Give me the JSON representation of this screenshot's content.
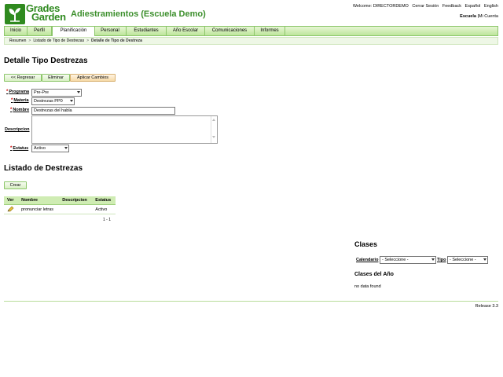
{
  "brand": {
    "line1": "Grades",
    "line2": "Garden",
    "color": "#2f8a1f"
  },
  "app_title": "Adiestramientos (Escuela Demo)",
  "top_links": [
    "Welcome: DIRECTORDEMO",
    "Cerrar Sesión",
    "Feedback",
    "Español",
    "English"
  ],
  "school": {
    "bold": "Escuela",
    "sep": "|",
    "link": "Mi Cuenta"
  },
  "nav": [
    "Inicio",
    "Perfil",
    "Planificación",
    "Personal",
    "Estudiantes",
    "Año Escolar",
    "Comunicaciones",
    "Informes"
  ],
  "nav_active": "Planificación",
  "breadcrumb": {
    "items": [
      "Resumen",
      "Listado de Tipo de Destrezas"
    ],
    "current": "Detalle de Tipo de Destreza",
    "sep": ">"
  },
  "detail": {
    "title": "Detalle Tipo Destrezas",
    "buttons": {
      "back": "<< Regresar",
      "delete": "Eliminar",
      "apply": "Aplicar Cambios"
    },
    "fields": {
      "programa": {
        "label": "Programa",
        "value": "Pre-Pre"
      },
      "materia": {
        "label": "Materia",
        "value": "Destrezas PP0"
      },
      "nombre": {
        "label": "Nombre",
        "value": "Destrezas del habla"
      },
      "descripcion": {
        "label": "Descripcion",
        "value": ""
      },
      "estatus": {
        "label": "Estatus",
        "value": "Activo"
      }
    },
    "required_mark": "*"
  },
  "listado": {
    "title": "Listado de Destrezas",
    "create_label": "Crear",
    "columns": [
      "Ver",
      "Nombre",
      "Descripcion",
      "Estatus"
    ],
    "rows": [
      {
        "icon": "pencil-icon",
        "nombre": "pronunciar letras",
        "descripcion": "",
        "estatus": "Activo"
      }
    ],
    "pager": "1 - 1"
  },
  "clases": {
    "title": "Clases",
    "calendario": {
      "label": "Calendario",
      "value": "- Seleccione -"
    },
    "tipo": {
      "label": "Tipo",
      "value": "- Seleccione -"
    },
    "anio_title": "Clases del Año",
    "no_data": "no data found"
  },
  "release": "Release 3.3"
}
